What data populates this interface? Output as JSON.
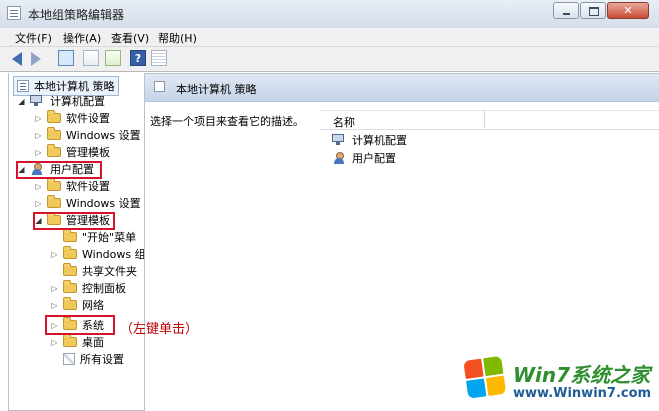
{
  "window": {
    "title": "本地组策略编辑器"
  },
  "menu": {
    "items": [
      "文件(F)",
      "操作(A)",
      "查看(V)",
      "帮助(H)"
    ]
  },
  "toolbar": {
    "help": "?"
  },
  "tree": {
    "root": "本地计算机 策略",
    "computer": "计算机配置",
    "computer_children": [
      "软件设置",
      "Windows 设置",
      "管理模板"
    ],
    "user": "用户配置",
    "user_children": [
      "软件设置",
      "Windows 设置",
      "管理模板"
    ],
    "admin_children": [
      "\"开始\"菜单",
      "Windows 组",
      "共享文件夹",
      "控制面板",
      "网络",
      "系统",
      "桌面",
      "所有设置"
    ]
  },
  "right": {
    "title": "本地计算机 策略",
    "description": "选择一个项目来查看它的描述。",
    "column_name": "名称",
    "items": [
      "计算机配置",
      "用户配置"
    ]
  },
  "annotation": "（左键单击）",
  "watermark": {
    "title": "Win7系统之家",
    "url": "www.Winwin7.com"
  }
}
